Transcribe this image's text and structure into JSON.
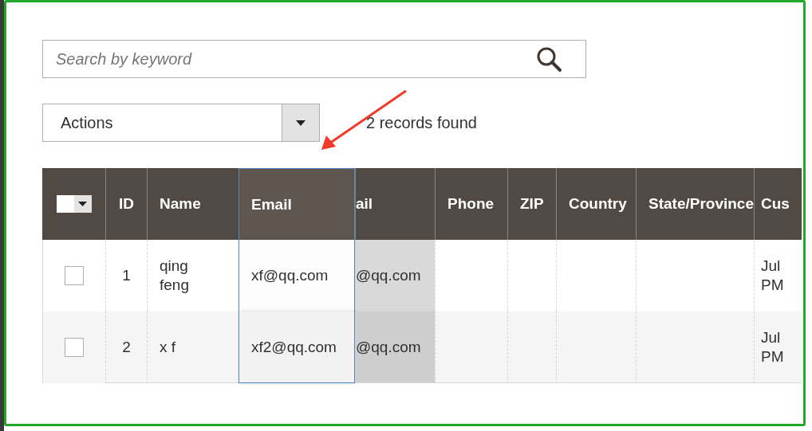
{
  "search": {
    "placeholder": "Search by keyword"
  },
  "actions": {
    "label": "Actions"
  },
  "records": "2 records found",
  "table": {
    "columns": [
      {
        "kind": "checkbox"
      },
      {
        "kind": "number",
        "label": "ID"
      },
      {
        "kind": "text",
        "label": "Name"
      },
      {
        "kind": "dragged",
        "label": "Email"
      },
      {
        "kind": "drop-target",
        "label": "ail"
      },
      {
        "kind": "text",
        "label": "Phone"
      },
      {
        "kind": "text",
        "label": "ZIP"
      },
      {
        "kind": "text",
        "label": "Country"
      },
      {
        "kind": "text",
        "label": "State/Province"
      },
      {
        "kind": "text",
        "label": "Cus"
      }
    ],
    "rows": [
      {
        "checked": false,
        "cells": [
          null,
          "1",
          "qing\nfeng",
          "xf@qq.com",
          "@qq.com",
          null,
          null,
          null,
          null,
          "Jul\nPM"
        ]
      },
      {
        "checked": false,
        "cells": [
          null,
          "2",
          "x f",
          "xf2@qq.com",
          "@qq.com",
          null,
          null,
          null,
          null,
          "Jul\nPM"
        ]
      }
    ]
  }
}
